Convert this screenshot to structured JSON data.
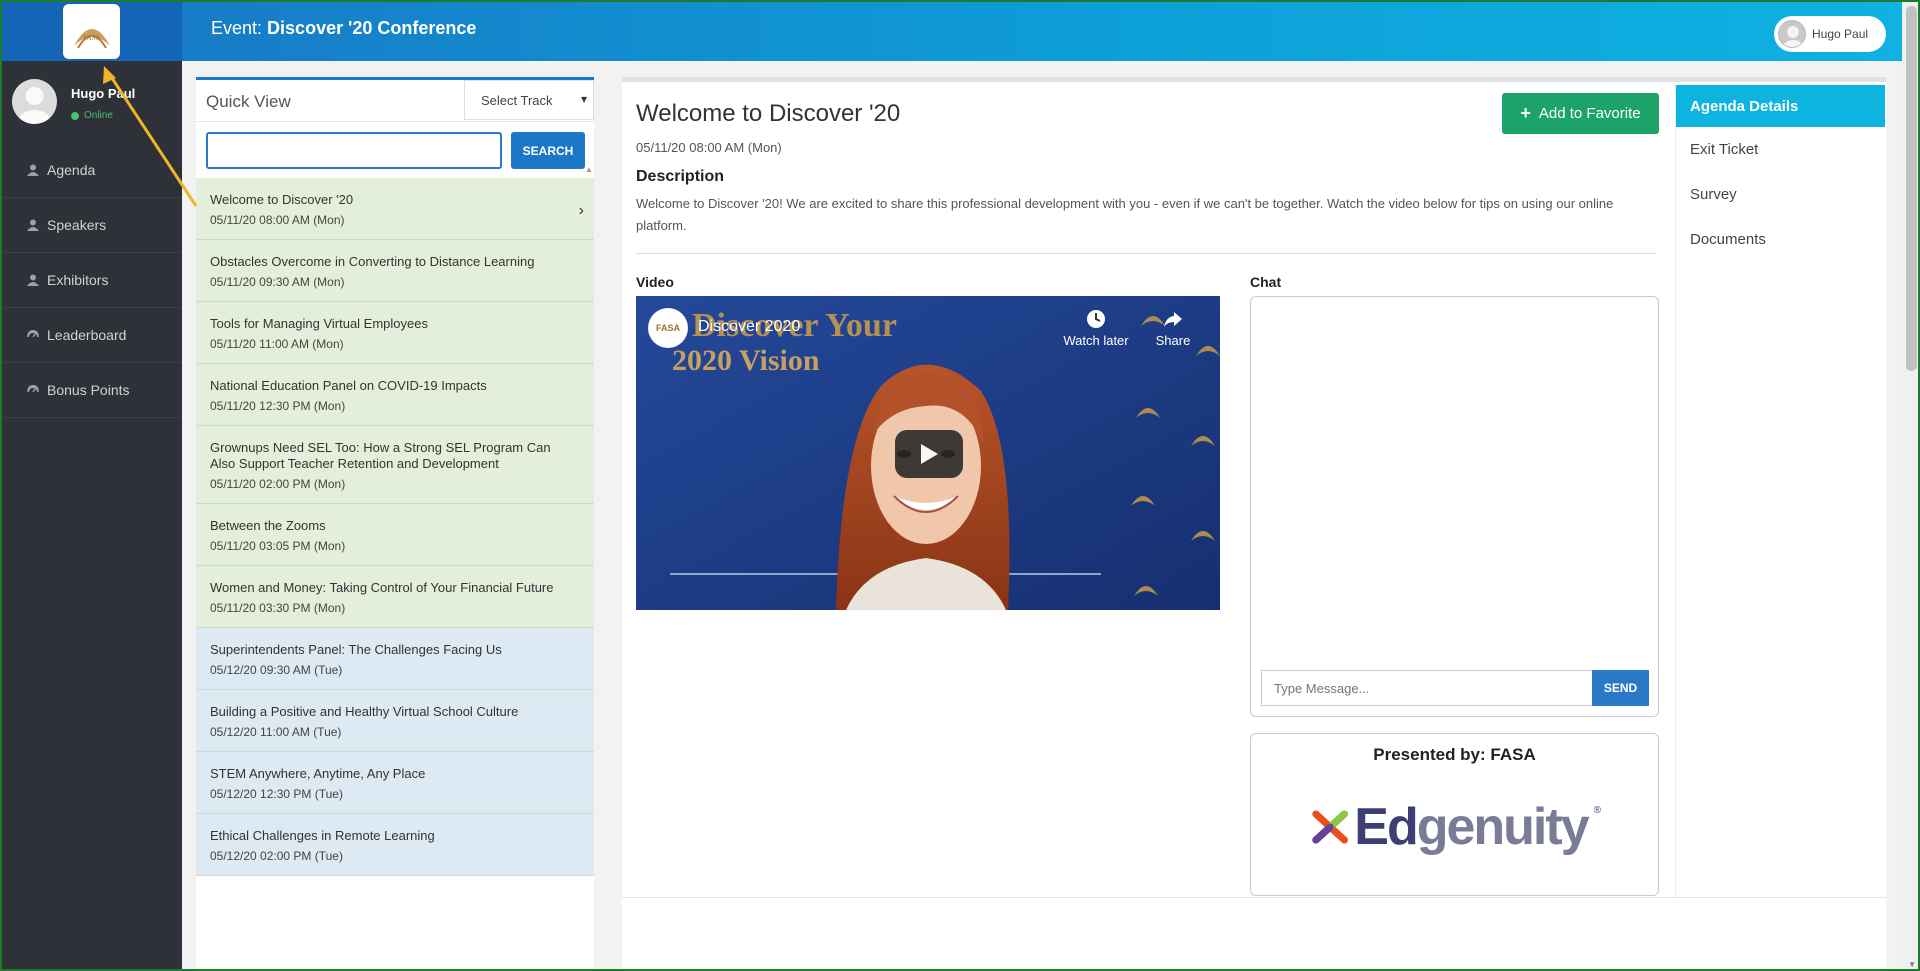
{
  "header": {
    "event_prefix": "Event:",
    "event_name": "Discover '20 Conference",
    "user_name": "Hugo Paul",
    "logo_text": "FASA"
  },
  "sidebar": {
    "user_name": "Hugo Paul",
    "status": "Online",
    "items": [
      {
        "label": "Agenda",
        "icon": "user-icon"
      },
      {
        "label": "Speakers",
        "icon": "user-icon"
      },
      {
        "label": "Exhibitors",
        "icon": "user-icon"
      },
      {
        "label": "Leaderboard",
        "icon": "dashboard-icon"
      },
      {
        "label": "Bonus Points",
        "icon": "dashboard-icon"
      }
    ]
  },
  "quick_view": {
    "title": "Quick View",
    "track_select": "Select Track",
    "search_value": "",
    "search_label": "SEARCH",
    "sessions": [
      {
        "title": "Welcome to Discover '20",
        "date": "05/11/20 08:00 AM (Mon)",
        "color": "green"
      },
      {
        "title": "Obstacles Overcome in Converting to Distance Learning",
        "date": "05/11/20 09:30 AM (Mon)",
        "color": "green"
      },
      {
        "title": "Tools for Managing Virtual Employees",
        "date": "05/11/20 11:00 AM (Mon)",
        "color": "green"
      },
      {
        "title": "National Education Panel on COVID-19 Impacts",
        "date": "05/11/20 12:30 PM (Mon)",
        "color": "green"
      },
      {
        "title": "Grownups Need SEL Too: How a Strong SEL Program Can Also Support Teacher Retention and Development",
        "date": "05/11/20 02:00 PM (Mon)",
        "color": "green"
      },
      {
        "title": "Between the Zooms",
        "date": "05/11/20 03:05 PM (Mon)",
        "color": "green"
      },
      {
        "title": "Women and Money: Taking Control of Your Financial Future",
        "date": "05/11/20 03:30 PM (Mon)",
        "color": "green"
      },
      {
        "title": "Superintendents Panel: The Challenges Facing Us",
        "date": "05/12/20 09:30 AM (Tue)",
        "color": "blue"
      },
      {
        "title": "Building a Positive and Healthy Virtual School Culture",
        "date": "05/12/20 11:00 AM (Tue)",
        "color": "blue"
      },
      {
        "title": "STEM Anywhere, Anytime, Any Place",
        "date": "05/12/20 12:30 PM (Tue)",
        "color": "blue"
      },
      {
        "title": "Ethical Challenges in Remote Learning",
        "date": "05/12/20 02:00 PM (Tue)",
        "color": "blue"
      }
    ]
  },
  "main": {
    "title": "Welcome to Discover '20",
    "date": "05/11/20 08:00 AM (Mon)",
    "favorite_label": "Add to Favorite",
    "description_label": "Description",
    "description": "Welcome to Discover '20! We are excited to share this professional development with you - even if we can't be together. Watch the video below for tips on using our online platform.",
    "video_label": "Video",
    "chat_label": "Chat",
    "video": {
      "title": "Discover 2020",
      "bg_text_1": "Discover Your",
      "bg_text_2": "2020 Vision",
      "watch_later": "Watch later",
      "share": "Share",
      "channel_logo": "FASA"
    },
    "chat_placeholder": "Type Message...",
    "send_label": "SEND",
    "presented_by": "Presented by: FASA",
    "sponsor_name_1": "Ed",
    "sponsor_name_2": "genuity",
    "sponsor_reg": "®"
  },
  "right_menu": {
    "items": [
      "Agenda Details",
      "Exit Ticket",
      "Survey",
      "Documents"
    ]
  },
  "colors": {
    "accent": "#0db4df",
    "brand_blue": "#1b78c7",
    "favorite_green": "#1ca36a",
    "sidebar_bg": "#2e3137",
    "session_green": "#e4efdb",
    "session_blue": "#dde9f3"
  }
}
